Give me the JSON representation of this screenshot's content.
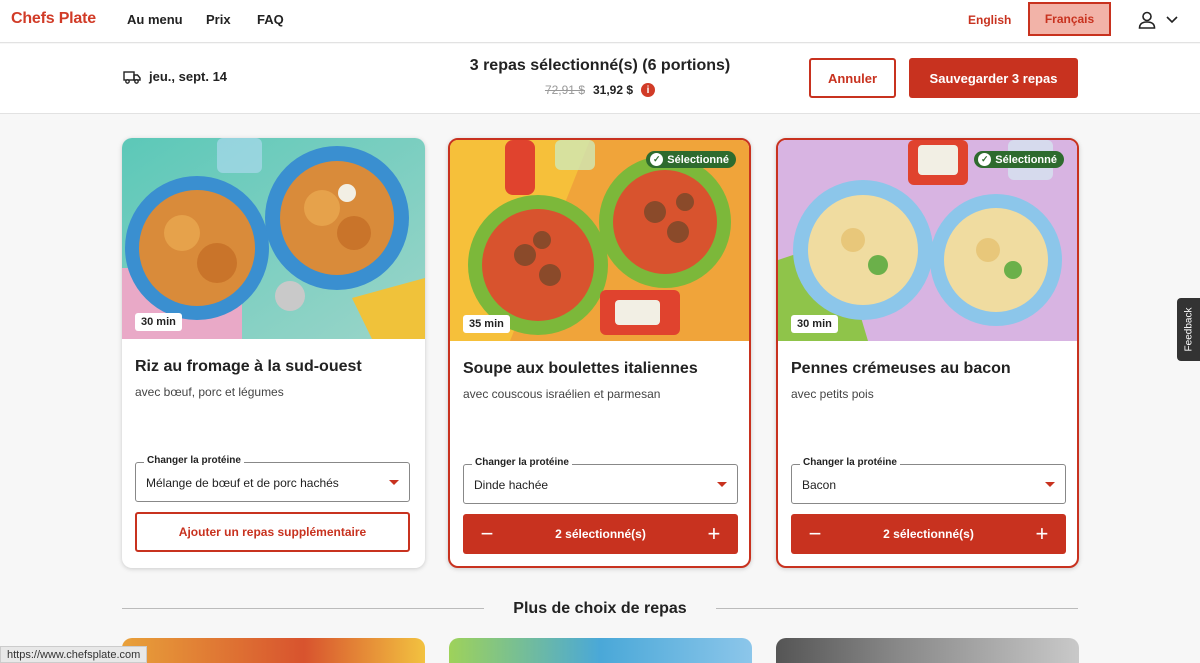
{
  "nav": {
    "logo": "Chefs Plate",
    "links": [
      "Au menu",
      "Prix",
      "FAQ"
    ],
    "lang_en": "English",
    "lang_fr": "Français"
  },
  "subheader": {
    "delivery_date": "jeu., sept. 14",
    "selection_title": "3 repas sélectionné(s) (6 portions)",
    "old_price": "72,91 $",
    "new_price": "31,92 $",
    "info_icon": "i",
    "cancel_label": "Annuler",
    "save_label": "Sauvegarder 3 repas"
  },
  "cards": [
    {
      "title": "Riz au fromage à la sud-ouest",
      "subtitle": "avec bœuf, porc et légumes",
      "time": "30 min",
      "selected": false,
      "protein_label": "Changer la protéine",
      "protein_value": "Mélange de bœuf et de porc hachés",
      "add_label": "Ajouter un repas supplémentaire"
    },
    {
      "title": "Soupe aux boulettes italiennes",
      "subtitle": "avec couscous israélien et parmesan",
      "time": "35 min",
      "selected": true,
      "selected_badge": "Sélectionné",
      "protein_label": "Changer la protéine",
      "protein_value": "Dinde hachée",
      "stepper_label": "2 sélectionné(s)"
    },
    {
      "title": "Pennes crémeuses au bacon",
      "subtitle": "avec petits pois",
      "time": "30 min",
      "selected": true,
      "selected_badge": "Sélectionné",
      "protein_label": "Changer la protéine",
      "protein_value": "Bacon",
      "stepper_label": "2 sélectionné(s)"
    }
  ],
  "more_section": {
    "title": "Plus de choix de repas"
  },
  "feedback_label": "Feedback",
  "status_url": "https://www.chefsplate.com",
  "colors": {
    "brand_red": "#c8321f",
    "selected_green": "#2e6b2e"
  }
}
